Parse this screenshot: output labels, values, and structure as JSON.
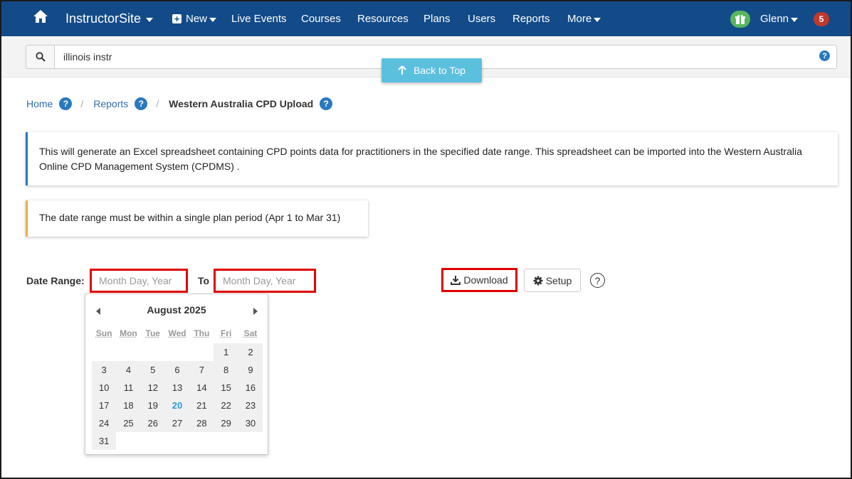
{
  "navbar": {
    "brand": "InstructorSite",
    "new_label": "New",
    "items": [
      "Live Events",
      "Courses",
      "Resources",
      "Plans",
      "Users",
      "Reports"
    ],
    "more_label": "More",
    "user_label": "Glenn",
    "notification_count": "5"
  },
  "search": {
    "value": "illinois instr",
    "help": "?"
  },
  "back_to_top": "Back to Top",
  "breadcrumb": {
    "home": "Home",
    "reports": "Reports",
    "current": "Western Australia CPD Upload",
    "help": "?",
    "separator": "/"
  },
  "info_text": "This will generate an Excel spreadsheet containing CPD points data for practitioners in the specified date range. This spreadsheet can be imported into the Western Australia Online CPD Management System (CPDMS) .",
  "warning_text": "The date range must be within a single plan period (Apr 1 to Mar 31)",
  "date_range": {
    "label": "Date Range:",
    "from_placeholder": "Month Day, Year",
    "to_label": "To",
    "to_placeholder": "Month Day, Year",
    "download_label": "Download",
    "setup_label": "Setup",
    "help": "?"
  },
  "calendar": {
    "month": "August",
    "year": "2025",
    "weekdays": [
      "Sun",
      "Mon",
      "Tue",
      "Wed",
      "Thu",
      "Fri",
      "Sat"
    ],
    "weeks": [
      [
        "",
        "",
        "",
        "",
        "",
        "1",
        "2"
      ],
      [
        "3",
        "4",
        "5",
        "6",
        "7",
        "8",
        "9"
      ],
      [
        "10",
        "11",
        "12",
        "13",
        "14",
        "15",
        "16"
      ],
      [
        "17",
        "18",
        "19",
        "20",
        "21",
        "22",
        "23"
      ],
      [
        "24",
        "25",
        "26",
        "27",
        "28",
        "29",
        "30"
      ],
      [
        "31",
        "",
        "",
        "",
        "",
        "",
        ""
      ]
    ],
    "today": "20"
  },
  "colors": {
    "navbar": "#134b89",
    "accent": "#2a79c0",
    "highlight_border": "#e00000",
    "back_to_top": "#5bc0de",
    "warning": "#f0ad4e"
  }
}
